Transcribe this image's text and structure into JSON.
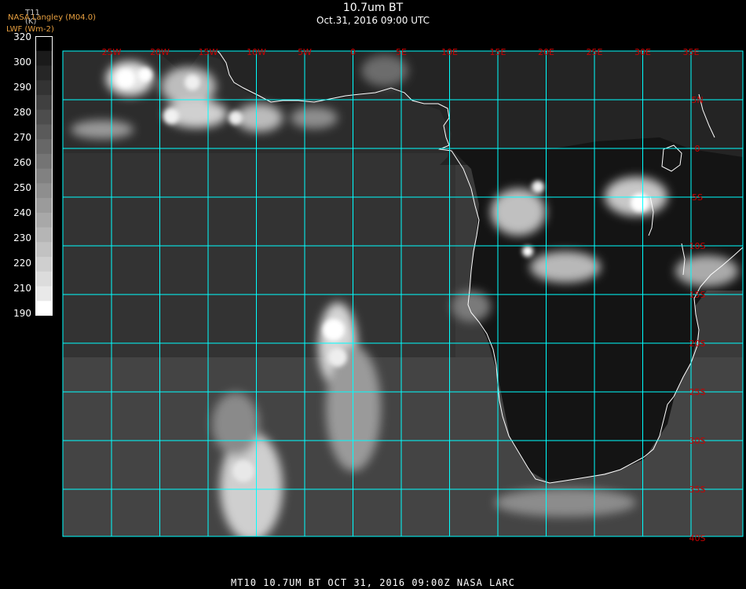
{
  "header": {
    "title": "10.7um BT",
    "subtitle": "Oct.31, 2016 09:00 UTC",
    "org_line": "NASA Langley (M04.0)",
    "lwf_line": "LWF (Wm-2)"
  },
  "colorbar": {
    "title_line1": "T11",
    "title_line2": "(K)",
    "ticks": [
      "320",
      "300",
      "290",
      "280",
      "270",
      "260",
      "250",
      "240",
      "230",
      "220",
      "210",
      "190"
    ],
    "steps": [
      "#000000",
      "#1a1a1a",
      "#262626",
      "#333333",
      "#404040",
      "#4d4d4d",
      "#5a5a5a",
      "#676767",
      "#747474",
      "#818181",
      "#8e8e8e",
      "#9b9b9b",
      "#a8a8a8",
      "#b5b5b5",
      "#c2c2c2",
      "#cfcfcf",
      "#dcdcdc",
      "#e9e9e9",
      "#ffffff"
    ]
  },
  "map": {
    "grid_color": "#00ffff",
    "label_color": "#cc0000",
    "coast_color": "#ffffff",
    "lon_labels": [
      "25W",
      "20W",
      "15W",
      "10W",
      "5W",
      "0",
      "5E",
      "10E",
      "15E",
      "20E",
      "25E",
      "30E",
      "35E"
    ],
    "lat_labels": [
      "5N",
      "0",
      "5S",
      "10S",
      "15S",
      "20S",
      "25S",
      "30S",
      "35S",
      "40S"
    ]
  },
  "footer": {
    "text": "MT10   10.7UM BT   OCT 31, 2016 09:00Z   NASA LARC"
  }
}
